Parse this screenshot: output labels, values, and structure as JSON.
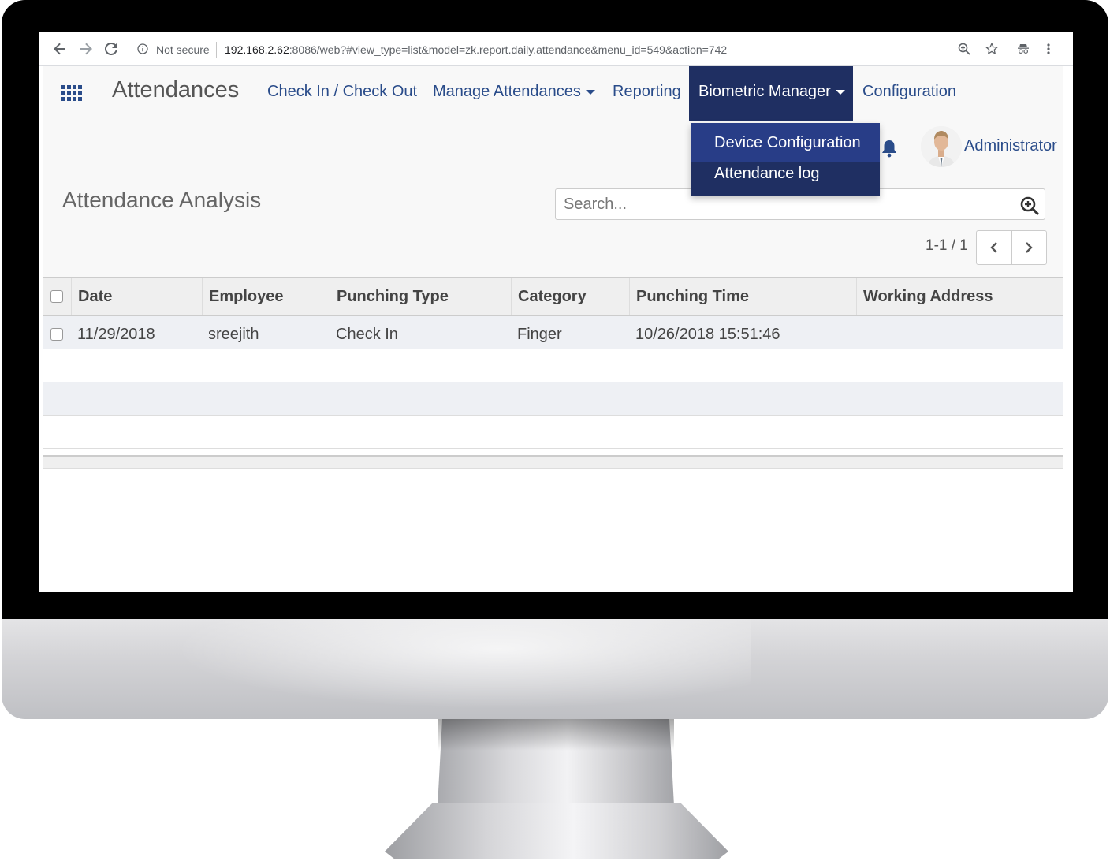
{
  "browser": {
    "security_label": "Not secure",
    "url_host": "192.168.2.62",
    "url_rest": ":8086/web?#view_type=list&model=zk.report.daily.attendance&menu_id=549&action=742"
  },
  "nav": {
    "app_title": "Attendances",
    "menu": [
      {
        "label": "Check In / Check Out"
      },
      {
        "label": "Manage Attendances"
      },
      {
        "label": "Reporting"
      },
      {
        "label": "Biometric Manager"
      },
      {
        "label": "Configuration"
      }
    ],
    "dropdown": [
      {
        "label": "Device Configuration"
      },
      {
        "label": "Attendance log"
      }
    ],
    "user_name": "Administrator"
  },
  "control_panel": {
    "title": "Attendance Analysis",
    "search_placeholder": "Search...",
    "pager": "1-1 / 1"
  },
  "table": {
    "columns": [
      "Date",
      "Employee",
      "Punching Type",
      "Category",
      "Punching Time",
      "Working Address"
    ],
    "rows": [
      {
        "date": "11/29/2018",
        "employee": "sreejith",
        "punching_type": "Check In",
        "category": "Finger",
        "punching_time": "10/26/2018 15:51:46",
        "working_address": ""
      }
    ]
  },
  "colors": {
    "brand_nav": "#1f2f62",
    "link": "#2a4c8a"
  }
}
